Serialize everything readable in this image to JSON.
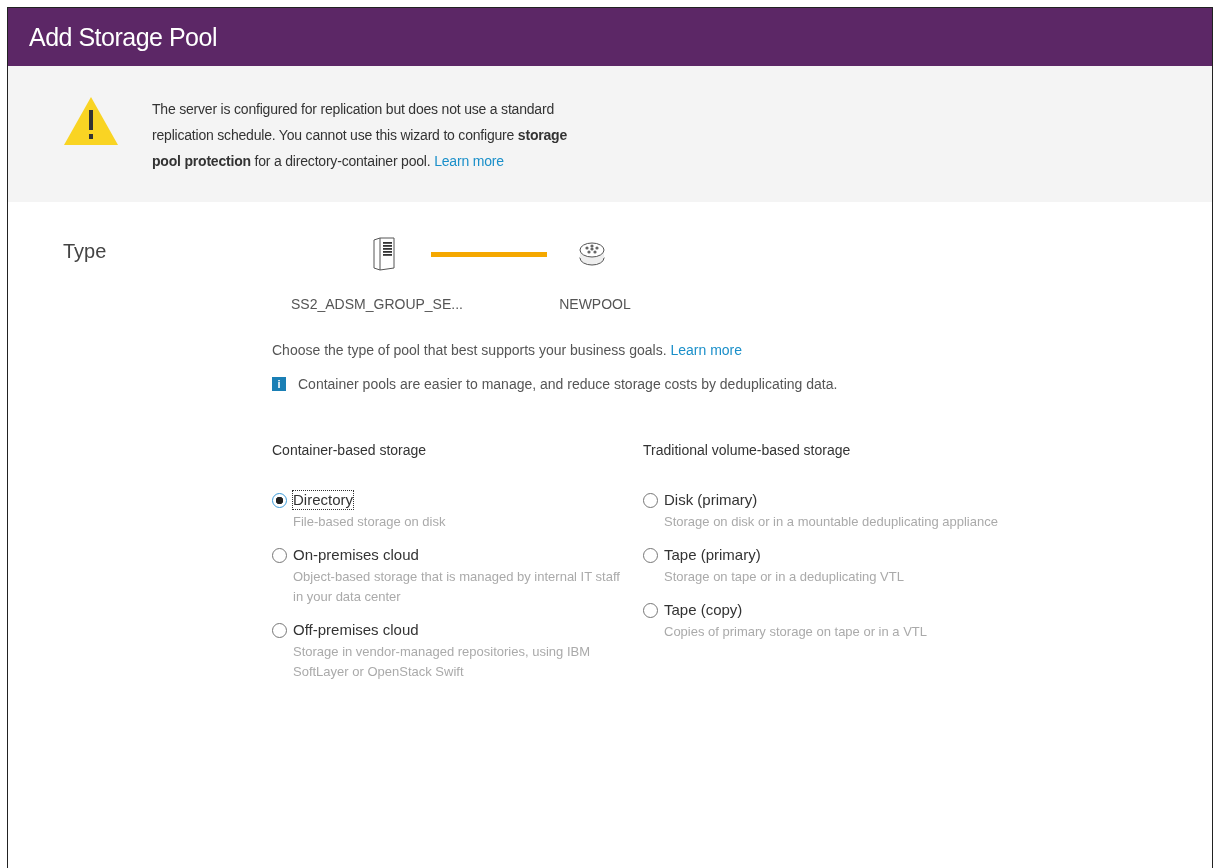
{
  "window": {
    "title": "Add Storage Pool"
  },
  "warning": {
    "text": "The server is configured for replication but does not use a standard replication schedule. You cannot use this wizard to configure **storage pool protection** for a directory-container pool.",
    "link": "Learn more"
  },
  "section": {
    "label": "Type"
  },
  "diagram": {
    "source": "SS2_ADSM_GROUP_SE...",
    "target": "NEWPOOL"
  },
  "intro": {
    "text": "Choose the type of pool that best supports your business goals.",
    "link": "Learn more"
  },
  "info": {
    "icon": "i",
    "text": "Container pools are easier to manage, and reduce storage costs by deduplicating data."
  },
  "groups": [
    {
      "heading": "Container-based storage",
      "options": [
        {
          "label": "Directory",
          "description": "File-based storage on disk",
          "selected": true
        },
        {
          "label": "On-premises cloud",
          "description": "Object-based storage that is managed by internal IT staff in your data center",
          "selected": false
        },
        {
          "label": "Off-premises cloud",
          "description": "Storage in vendor-managed repositories, using IBM SoftLayer or OpenStack Swift",
          "selected": false
        }
      ]
    },
    {
      "heading": "Traditional volume-based storage",
      "options": [
        {
          "label": "Disk (primary)",
          "description": "Storage on disk or in a mountable deduplicating appliance",
          "selected": false
        },
        {
          "label": "Tape (primary)",
          "description": "Storage on tape or in a deduplicating VTL",
          "selected": false
        },
        {
          "label": "Tape (copy)",
          "description": "Copies of primary storage on tape or in a VTL",
          "selected": false
        }
      ]
    }
  ]
}
